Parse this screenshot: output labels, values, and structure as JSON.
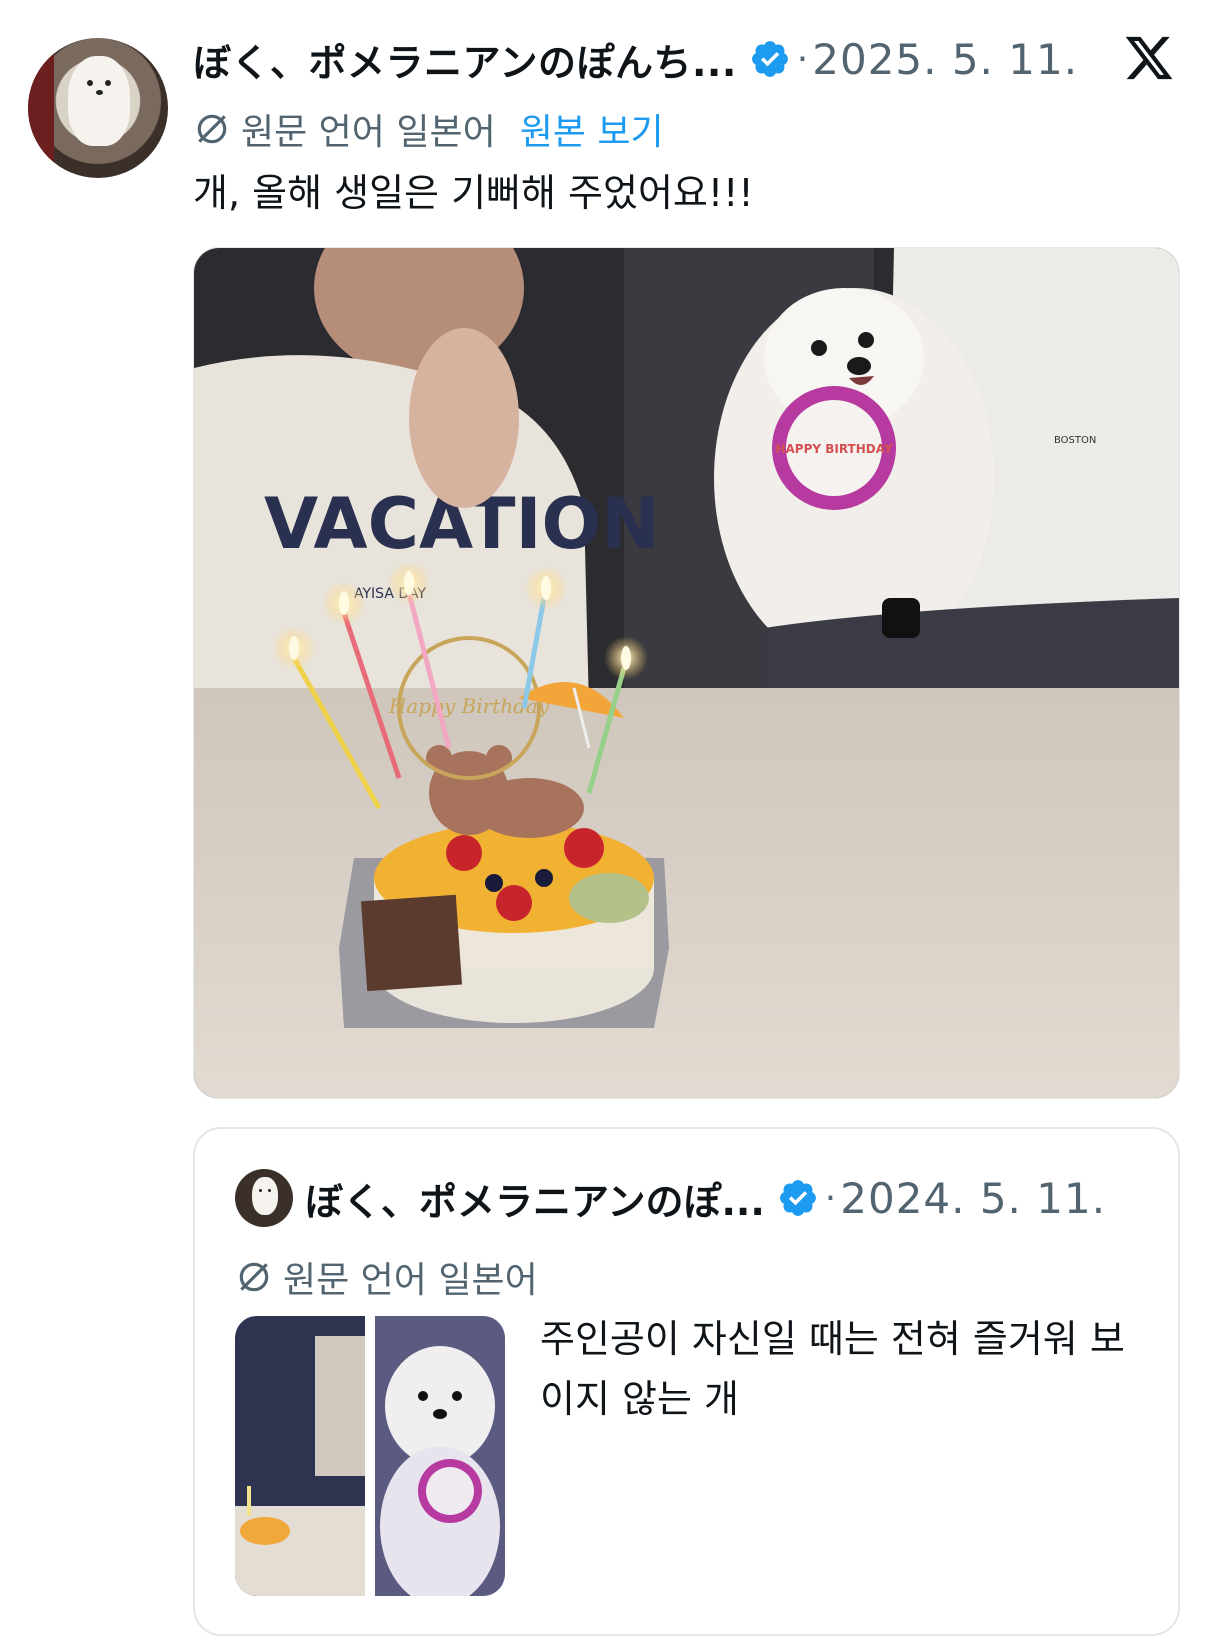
{
  "header": {
    "author_name": "ぼく、ポメラニアンのぽんち...",
    "verified": true,
    "separator": "·",
    "date": "2025. 5. 11.",
    "platform_icon": "x-logo-icon"
  },
  "translation": {
    "label": "원문 언어 일본어",
    "show_original": "원본 보기",
    "icon": "translate-icon"
  },
  "tweet": {
    "text": "개, 올해 생일은 기뻐해 주었어요!!!",
    "media": {
      "kind": "photo",
      "badge_text": "HAPPY BIRTHDAY",
      "topper_text": "Happy Birthday",
      "shirt_text_left": "VACATION",
      "shirt_text_right": "BOSTON",
      "shirt_subtext": "AYISA DAY"
    }
  },
  "quote": {
    "author_name": "ぼく、ポメラニアンのぽ...",
    "verified": true,
    "separator": "·",
    "date": "2024. 5. 11.",
    "translation_label": "원문 언어 일본어",
    "text": "주인공이 자신일 때는 전혀 즐거워 보이지 않는 개"
  },
  "colors": {
    "accent": "#1d9bf0",
    "text_primary": "#0f1419",
    "text_secondary": "#536471",
    "border": "#e3e7ea"
  }
}
